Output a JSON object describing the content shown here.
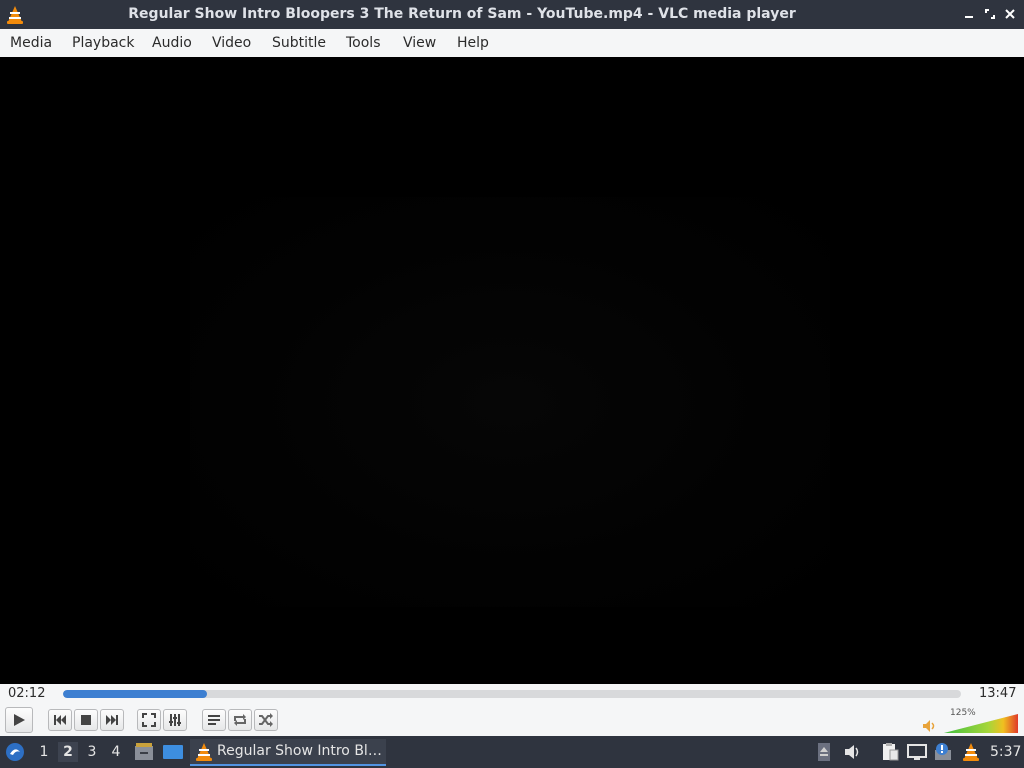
{
  "window": {
    "title": "Regular Show Intro Bloopers 3 The Return of Sam - YouTube.mp4 - VLC media player",
    "buttons": {
      "minimize_icon": "minimize-icon",
      "maximize_icon": "restore-icon",
      "close_icon": "close-icon"
    }
  },
  "menu": {
    "items": [
      {
        "label": "Media"
      },
      {
        "label": "Playback"
      },
      {
        "label": "Audio"
      },
      {
        "label": "Video"
      },
      {
        "label": "Subtitle"
      },
      {
        "label": "Tools"
      },
      {
        "label": "View"
      },
      {
        "label": "Help"
      }
    ]
  },
  "player": {
    "elapsed": "02:12",
    "total": "13:47",
    "progress_fraction": 0.16,
    "volume_label": "125%",
    "volume_fraction": 1.0,
    "accent_color": "#3d7fd1"
  },
  "controls": {
    "buttons": [
      "play-icon",
      "previous-icon",
      "stop-icon",
      "next-icon",
      "fullscreen-icon",
      "extended-settings-icon",
      "playlist-icon",
      "loop-icon",
      "shuffle-icon"
    ]
  },
  "taskbar": {
    "workspaces": [
      "1",
      "2",
      "3",
      "4"
    ],
    "active_workspace": "2",
    "task_label": "Regular Show Intro Bl…",
    "clock": "5:37"
  }
}
